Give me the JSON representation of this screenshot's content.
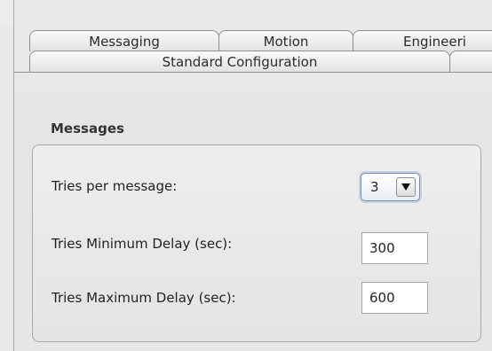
{
  "tabs": {
    "row1": [
      "Messaging",
      "Motion",
      "Engineeri"
    ],
    "row2": [
      "Standard Configuration",
      ""
    ]
  },
  "group": {
    "title": "Messages"
  },
  "fields": {
    "tries_label": "Tries per message:",
    "tries_value": "3",
    "min_delay_label": "Tries Minimum Delay (sec):",
    "min_delay_value": "300",
    "max_delay_label": "Tries Maximum Delay (sec):",
    "max_delay_value": "600"
  },
  "icons": {
    "combo_arrow": "dropdown-arrow-icon"
  }
}
